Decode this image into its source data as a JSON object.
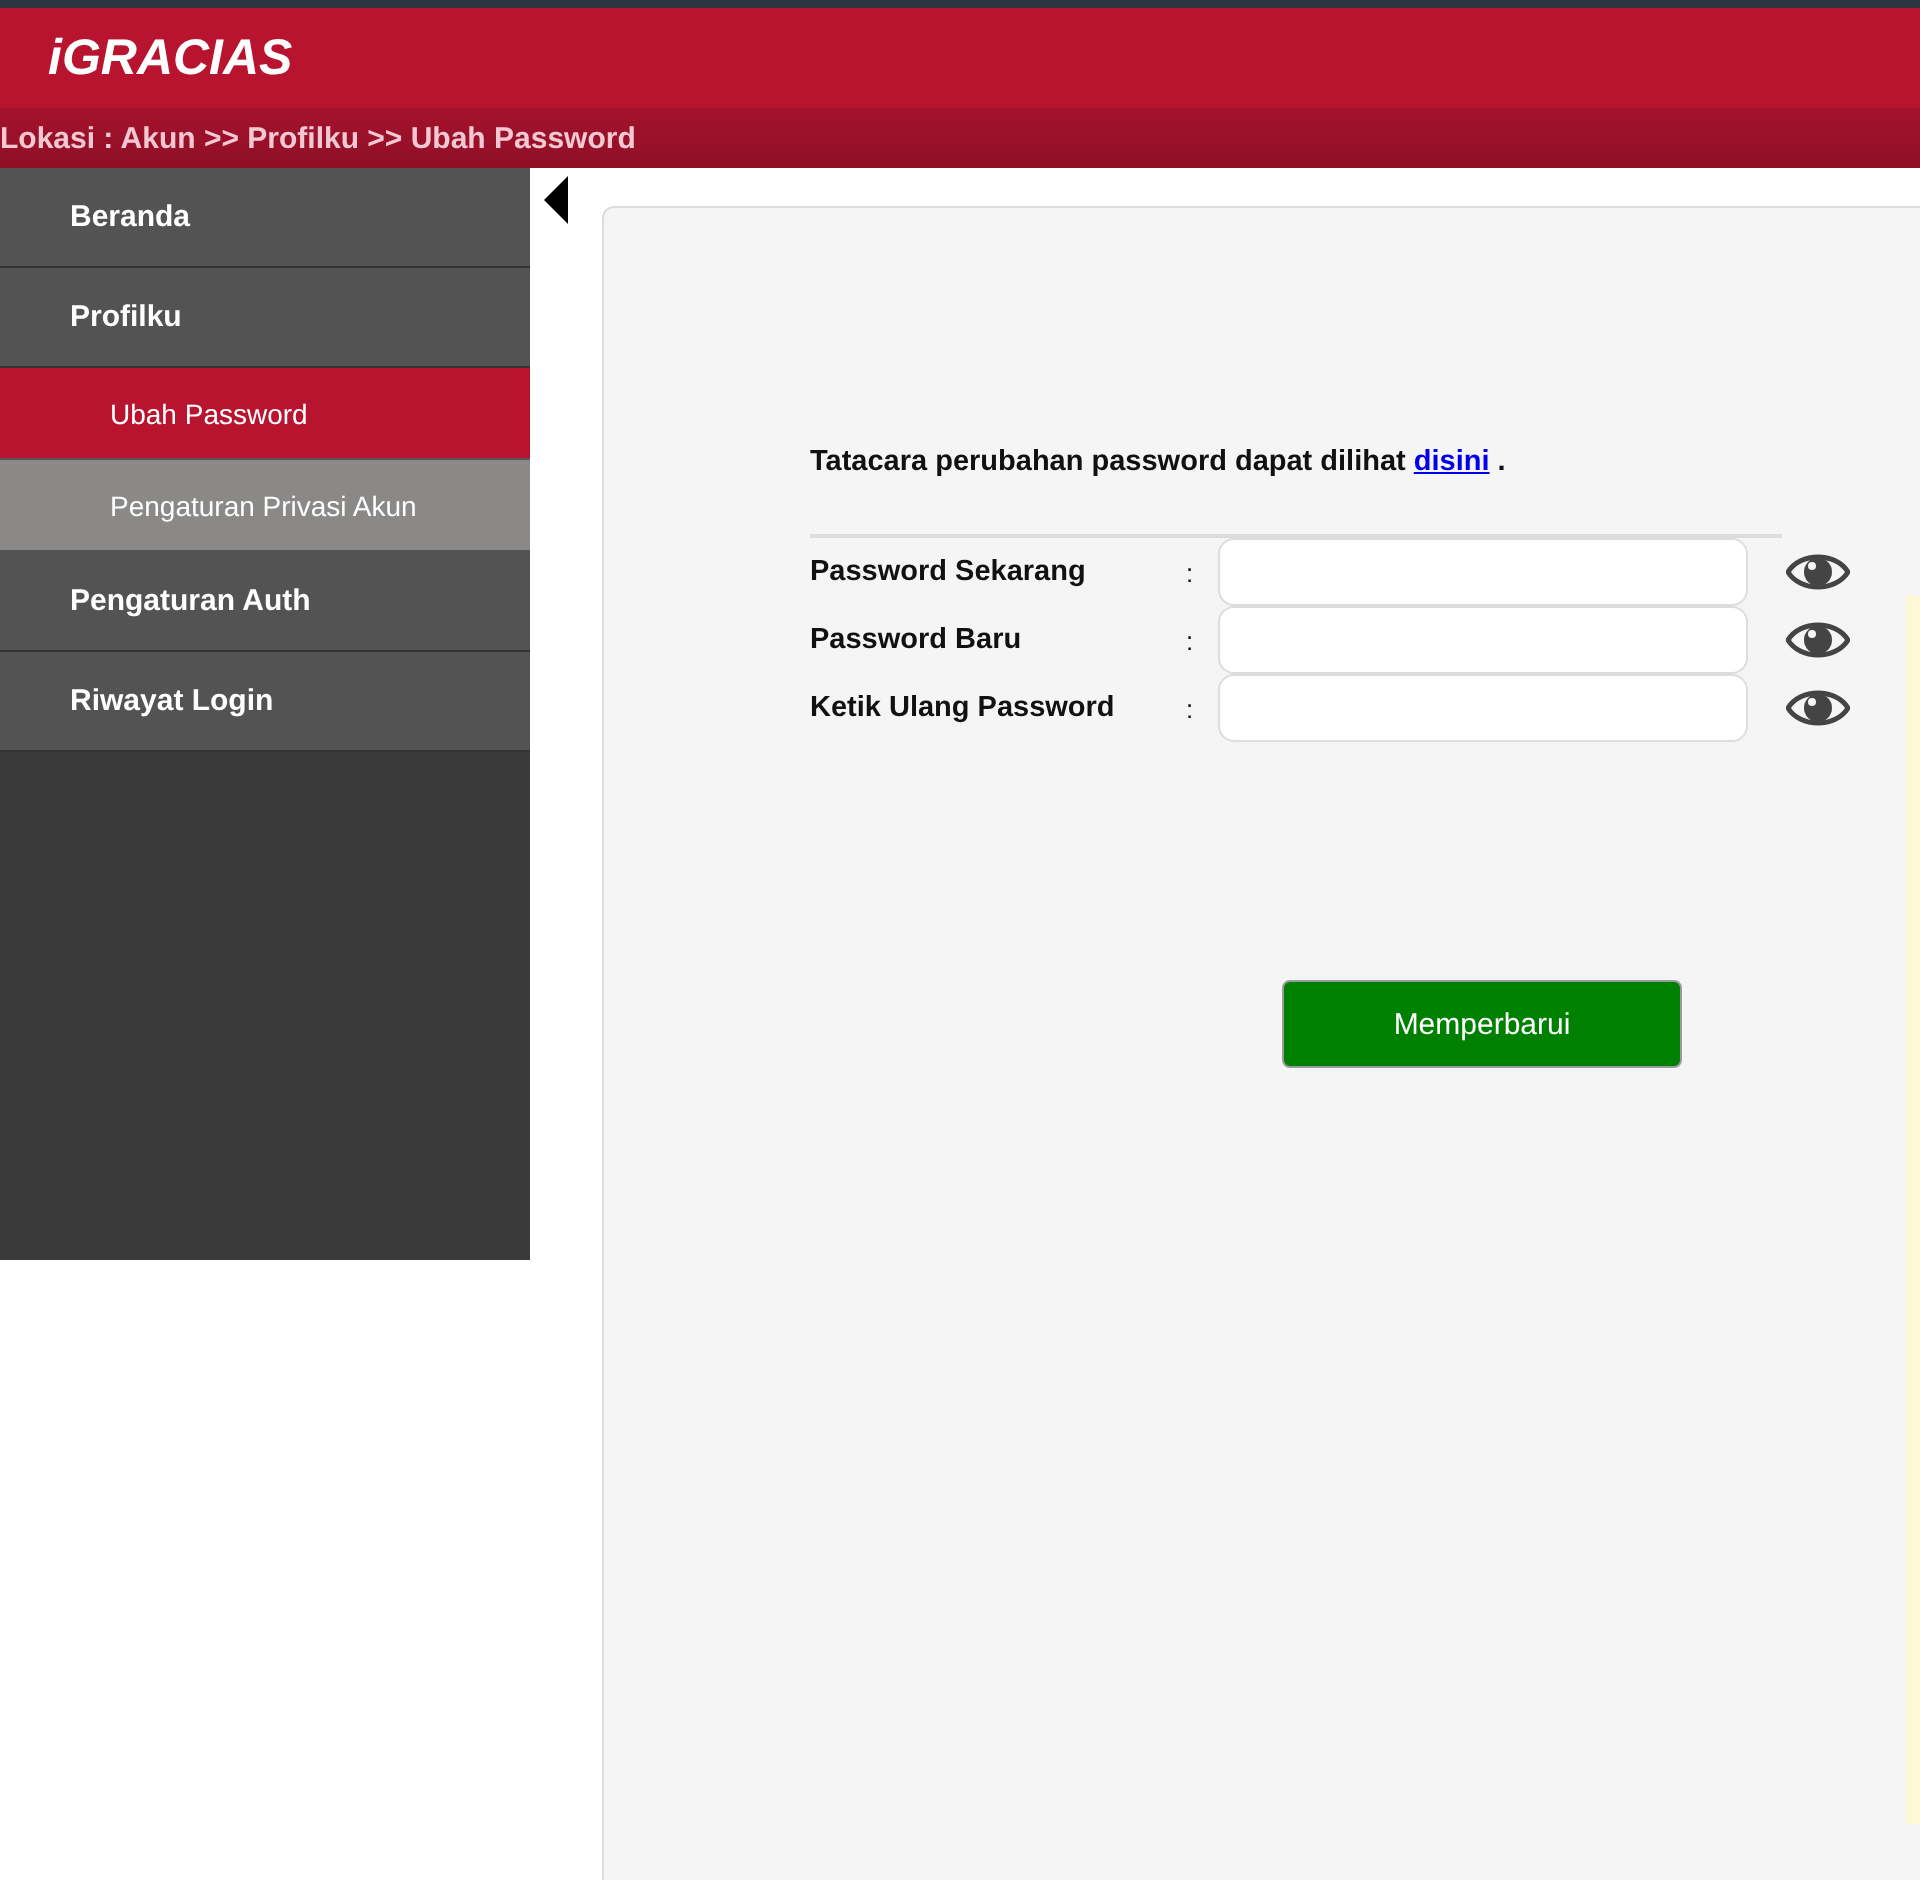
{
  "header": {
    "logo": "iGRACIAS",
    "breadcrumb": "Lokasi : Akun >> Profilku >> Ubah Password"
  },
  "sidebar": {
    "items": [
      {
        "label": "Beranda",
        "selected": false
      },
      {
        "label": "Profilku",
        "selected": false,
        "children": [
          {
            "label": "Ubah Password",
            "selected": true
          },
          {
            "label": "Pengaturan Privasi Akun",
            "selected": false
          }
        ]
      },
      {
        "label": "Pengaturan Auth",
        "selected": false
      },
      {
        "label": "Riwayat Login",
        "selected": false
      }
    ]
  },
  "form": {
    "intro": {
      "text": "Tatacara perubahan password dapat dilihat",
      "link": "disini",
      "tail": "."
    },
    "fields": [
      {
        "label": "Password Sekarang",
        "separator": ":"
      },
      {
        "label": "Password Baru",
        "separator": ":"
      },
      {
        "label": "Ketik Ulang Password",
        "separator": ":"
      }
    ],
    "submit": "Memperbarui"
  }
}
